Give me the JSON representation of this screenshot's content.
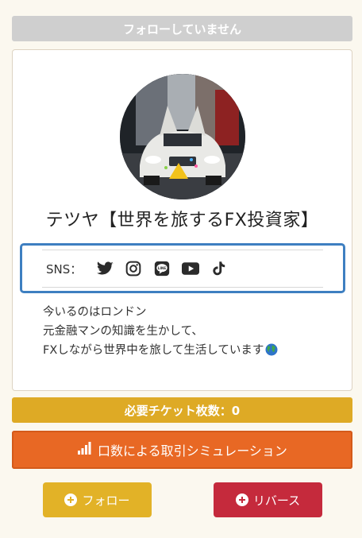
{
  "status": {
    "label": "フォローしていません"
  },
  "profile": {
    "name": "テツヤ【世界を旅するFX投資家】",
    "sns": {
      "label": "SNS：",
      "icons": [
        "twitter-icon",
        "instagram-icon",
        "line-icon",
        "youtube-icon",
        "tiktok-icon"
      ]
    },
    "bio": [
      "今いるのはロンドン",
      "元金融マンの知識を生かして、",
      "FXしながら世界中を旅して生活しています"
    ]
  },
  "ticket": {
    "label": "必要チケット枚数：0"
  },
  "simulation": {
    "label": "口数による取引シミュレーション"
  },
  "actions": {
    "follow_label": "フォロー",
    "reverse_label": "リバース"
  },
  "colors": {
    "status_bg": "#cfcfcf",
    "ticket_bg": "#deaa25",
    "simulation_bg": "#e86824",
    "follow_bg": "#e2b227",
    "reverse_bg": "#c52a3c",
    "sns_border": "#3e7fc1"
  }
}
